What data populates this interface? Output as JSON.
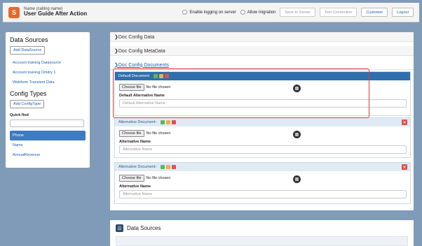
{
  "header": {
    "app_subtitle": "Name (calling name)",
    "app_title": "User Guide After Action",
    "enable_logging_label": "Enable logging on server",
    "allow_migration_label": "Allow migration",
    "save_to_server_label": "Save to Server",
    "test_connection_label": "Test Connection",
    "customer_label": "Customer",
    "logout_label": "Logout"
  },
  "sidebar": {
    "data_sources_title": "Data Sources",
    "add_datasource_label": "Add DataSource",
    "datasources": [
      "Account training Datasource",
      "Account training Dmitry 1",
      "Webform Transient Data"
    ],
    "config_types_title": "Config Types",
    "add_configtype_label": "Add ConfigType",
    "quick_find_label": "Quick find",
    "items": [
      "Phone",
      "Name",
      "AnnualRevenue"
    ],
    "selected_index": 0
  },
  "main": {
    "sections": [
      "❯Doc Config Data",
      "❯Doc Config MetaData",
      "❯Doc Config Documents"
    ],
    "default_card": {
      "title": "Default Document",
      "file_button": "Choose file",
      "file_status": "No file chosen",
      "alt_label": "Default Alternative Name",
      "alt_placeholder": "Default Alternative Name"
    },
    "alt_cards": [
      {
        "title": "Alternative Document:",
        "file_button": "Choose file",
        "file_status": "No file chosen",
        "alt_label": "Alternative Name",
        "alt_placeholder": "Alternative Name"
      },
      {
        "title": "Alternative Document:",
        "file_button": "Choose file",
        "file_status": "No file chosen",
        "alt_label": "Alternative Name",
        "alt_placeholder": "Alternative Name"
      }
    ]
  },
  "data_sources_panel": {
    "title": "Data Sources"
  },
  "colors": {
    "accent": "#2f6fad",
    "highlight": "#e03c31",
    "delete": "#d9534f"
  }
}
